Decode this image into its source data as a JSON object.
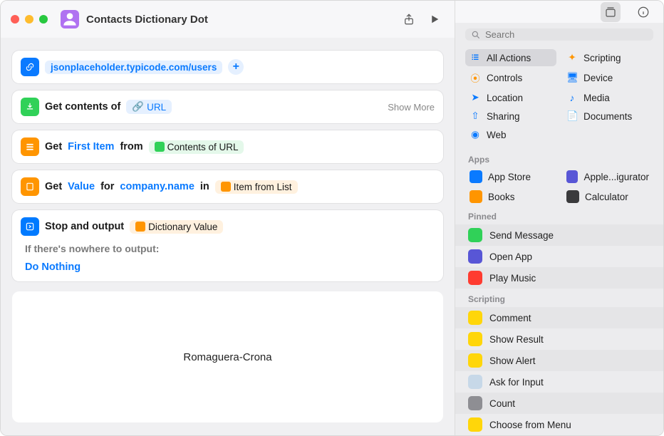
{
  "titlebar": {
    "title": "Contacts Dictionary Dot"
  },
  "workflow": {
    "url_step": {
      "value": "jsonplaceholder.typicode.com/users"
    },
    "get_contents": {
      "prefix": "Get contents of",
      "token": "URL",
      "show_more": "Show More"
    },
    "get_item": {
      "word_get": "Get",
      "first_item": "First Item",
      "word_from": "from",
      "source": "Contents of URL"
    },
    "get_value": {
      "word_get": "Get",
      "value": "Value",
      "word_for": "for",
      "key": "company.name",
      "word_in": "in",
      "source": "Item from List"
    },
    "stop": {
      "label": "Stop and output",
      "token": "Dictionary Value",
      "if_text": "If there's nowhere to output:",
      "do_nothing": "Do Nothing"
    },
    "result": "Romaguera-Crona"
  },
  "sidebar": {
    "search_placeholder": "Search",
    "categories": [
      {
        "name": "All Actions",
        "color": "c-blue",
        "icon": "list",
        "selected": true
      },
      {
        "name": "Scripting",
        "color": "c-orange",
        "icon": "wand"
      },
      {
        "name": "Controls",
        "color": "c-orange",
        "icon": "switch"
      },
      {
        "name": "Device",
        "color": "c-blue",
        "icon": "desktop"
      },
      {
        "name": "Location",
        "color": "c-blue",
        "icon": "arrow"
      },
      {
        "name": "Media",
        "color": "c-blue",
        "icon": "music"
      },
      {
        "name": "Sharing",
        "color": "c-blue",
        "icon": "share"
      },
      {
        "name": "Documents",
        "color": "c-blue",
        "icon": "doc"
      },
      {
        "name": "Web",
        "color": "c-blue",
        "icon": "globe"
      }
    ],
    "apps_header": "Apps",
    "apps": [
      {
        "name": "App Store",
        "bg": "#0a7aff"
      },
      {
        "name": "Apple...igurator",
        "bg": "#5856d6"
      },
      {
        "name": "Books",
        "bg": "#ff9500"
      },
      {
        "name": "Calculator",
        "bg": "#3a3a3c"
      }
    ],
    "pinned_header": "Pinned",
    "pinned": [
      {
        "name": "Send Message",
        "bg": "#30d158"
      },
      {
        "name": "Open App",
        "bg": "#5856d6"
      },
      {
        "name": "Play Music",
        "bg": "#ff3b30"
      }
    ],
    "scripting_header": "Scripting",
    "scripting": [
      {
        "name": "Comment",
        "bg": "#ffd60a"
      },
      {
        "name": "Show Result",
        "bg": "#ffd60a"
      },
      {
        "name": "Show Alert",
        "bg": "#ffd60a"
      },
      {
        "name": "Ask for Input",
        "bg": "#c7d8e8"
      },
      {
        "name": "Count",
        "bg": "#8e8e93"
      },
      {
        "name": "Choose from Menu",
        "bg": "#ffd60a"
      }
    ]
  }
}
